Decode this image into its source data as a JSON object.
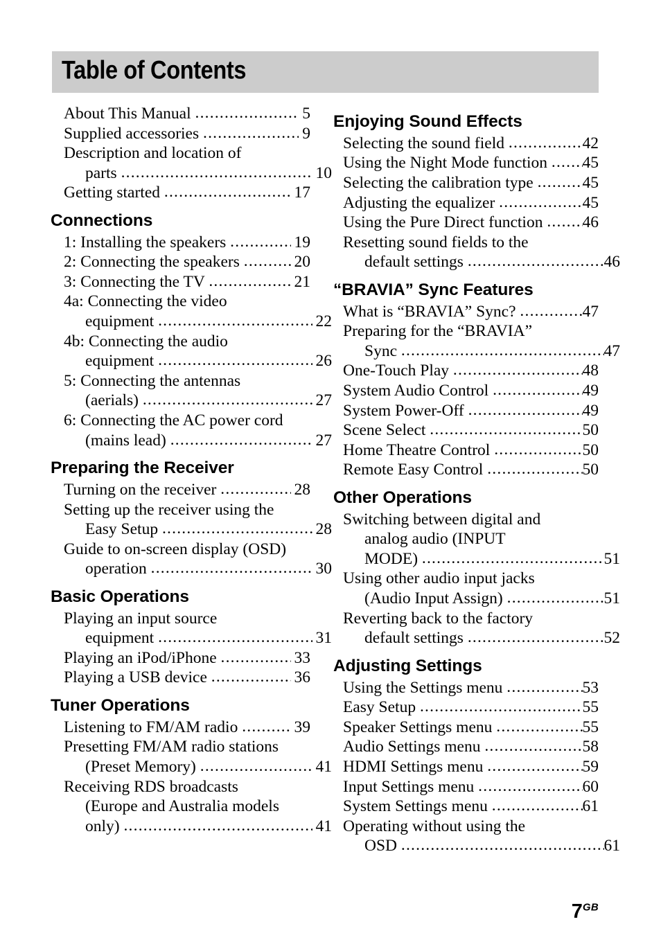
{
  "document": {
    "title": "Table of Contents",
    "title_band_color": "#cccccc",
    "page_number": "7",
    "page_suffix": "GB"
  },
  "left_column": {
    "intro_entries": [
      {
        "label": "About This Manual ",
        "page": "5",
        "leader": true
      },
      {
        "label": "Supplied accessories ",
        "page": "9",
        "leader": true
      },
      {
        "label": "Description and location of",
        "page": "",
        "leader": false
      },
      {
        "label": "parts ",
        "page": "10",
        "leader": true,
        "continuation": true
      },
      {
        "label": "Getting started ",
        "page": "17",
        "leader": true
      }
    ],
    "sections": [
      {
        "heading": "Connections",
        "entries": [
          {
            "label": "1: Installing the speakers ",
            "page": "19",
            "leader": true
          },
          {
            "label": "2: Connecting the speakers ",
            "page": "20",
            "leader": true
          },
          {
            "label": "3: Connecting the TV ",
            "page": "21",
            "leader": true
          },
          {
            "label": "4a: Connecting the video",
            "page": "",
            "leader": false
          },
          {
            "label": "equipment ",
            "page": "22",
            "leader": true,
            "continuation": true
          },
          {
            "label": "4b: Connecting the audio",
            "page": "",
            "leader": false
          },
          {
            "label": "equipment ",
            "page": "26",
            "leader": true,
            "continuation": true
          },
          {
            "label": "5: Connecting the antennas",
            "page": "",
            "leader": false
          },
          {
            "label": "(aerials) ",
            "page": "27",
            "leader": true,
            "continuation": true
          },
          {
            "label": "6: Connecting the AC power cord",
            "page": "",
            "leader": false
          },
          {
            "label": "(mains lead) ",
            "page": "27",
            "leader": true,
            "continuation": true
          }
        ]
      },
      {
        "heading": "Preparing the Receiver",
        "entries": [
          {
            "label": "Turning on the receiver ",
            "page": "28",
            "leader": true
          },
          {
            "label": "Setting up the receiver using the",
            "page": "",
            "leader": false
          },
          {
            "label": "Easy Setup ",
            "page": "28",
            "leader": true,
            "continuation": true
          },
          {
            "label": "Guide to on-screen display (OSD)",
            "page": "",
            "leader": false
          },
          {
            "label": "operation ",
            "page": "30",
            "leader": true,
            "continuation": true
          }
        ]
      },
      {
        "heading": "Basic Operations",
        "entries": [
          {
            "label": "Playing an input source",
            "page": "",
            "leader": false
          },
          {
            "label": "equipment ",
            "page": "31",
            "leader": true,
            "continuation": true
          },
          {
            "label": "Playing an iPod/iPhone ",
            "page": "33",
            "leader": true
          },
          {
            "label": "Playing a USB device ",
            "page": "36",
            "leader": true
          }
        ]
      },
      {
        "heading": "Tuner Operations",
        "entries": [
          {
            "label": "Listening to FM/AM radio ",
            "page": "39",
            "leader": true
          },
          {
            "label": "Presetting FM/AM radio stations",
            "page": "",
            "leader": false
          },
          {
            "label": "(Preset Memory) ",
            "page": "41",
            "leader": true,
            "continuation": true
          },
          {
            "label": "Receiving RDS broadcasts",
            "page": "",
            "leader": false
          },
          {
            "label": "(Europe and Australia models",
            "page": "",
            "leader": false,
            "continuation": true
          },
          {
            "label": "only) ",
            "page": "41",
            "leader": true,
            "continuation": true
          }
        ]
      }
    ]
  },
  "right_column": {
    "sections": [
      {
        "heading": "Enjoying Sound Effects",
        "entries": [
          {
            "label": "Selecting the sound field ",
            "page": "42",
            "leader": true
          },
          {
            "label": "Using the Night Mode function ",
            "page": "45",
            "leader": true
          },
          {
            "label": "Selecting the calibration type ",
            "page": "45",
            "leader": true
          },
          {
            "label": "Adjusting the equalizer ",
            "page": "45",
            "leader": true
          },
          {
            "label": "Using the Pure Direct function ",
            "page": "46",
            "leader": true
          },
          {
            "label": "Resetting sound fields to the",
            "page": "",
            "leader": false
          },
          {
            "label": "default settings ",
            "page": "46",
            "leader": true,
            "continuation": true
          }
        ]
      },
      {
        "heading": "“BRAVIA” Sync Features",
        "entries": [
          {
            "label": "What is “BRAVIA” Sync? ",
            "page": "47",
            "leader": true
          },
          {
            "label": "Preparing for the “BRAVIA”",
            "page": "",
            "leader": false
          },
          {
            "label": "Sync ",
            "page": "47",
            "leader": true,
            "continuation": true
          },
          {
            "label": "One-Touch Play ",
            "page": "48",
            "leader": true
          },
          {
            "label": "System Audio Control ",
            "page": "49",
            "leader": true
          },
          {
            "label": "System Power-Off ",
            "page": "49",
            "leader": true
          },
          {
            "label": "Scene Select ",
            "page": "50",
            "leader": true
          },
          {
            "label": "Home Theatre Control ",
            "page": "50",
            "leader": true
          },
          {
            "label": "Remote Easy Control ",
            "page": "50",
            "leader": true
          }
        ]
      },
      {
        "heading": "Other Operations",
        "entries": [
          {
            "label": "Switching between digital and",
            "page": "",
            "leader": false
          },
          {
            "label": "analog audio (INPUT",
            "page": "",
            "leader": false,
            "continuation": true
          },
          {
            "label": "MODE) ",
            "page": "51",
            "leader": true,
            "continuation": true
          },
          {
            "label": "Using other audio input jacks",
            "page": "",
            "leader": false
          },
          {
            "label": "(Audio Input Assign) ",
            "page": "51",
            "leader": true,
            "continuation": true
          },
          {
            "label": "Reverting back to the factory",
            "page": "",
            "leader": false
          },
          {
            "label": "default settings ",
            "page": "52",
            "leader": true,
            "continuation": true
          }
        ]
      },
      {
        "heading": "Adjusting Settings",
        "entries": [
          {
            "label": "Using the Settings menu ",
            "page": "53",
            "leader": true
          },
          {
            "label": "Easy Setup ",
            "page": "55",
            "leader": true
          },
          {
            "label": "Speaker Settings menu ",
            "page": "55",
            "leader": true
          },
          {
            "label": "Audio Settings menu ",
            "page": "58",
            "leader": true
          },
          {
            "label": "HDMI Settings menu ",
            "page": "59",
            "leader": true
          },
          {
            "label": "Input Settings menu ",
            "page": "60",
            "leader": true
          },
          {
            "label": "System Settings menu ",
            "page": "61",
            "leader": true
          },
          {
            "label": "Operating without using the",
            "page": "",
            "leader": false
          },
          {
            "label": "OSD ",
            "page": "61",
            "leader": true,
            "continuation": true
          }
        ]
      }
    ]
  }
}
